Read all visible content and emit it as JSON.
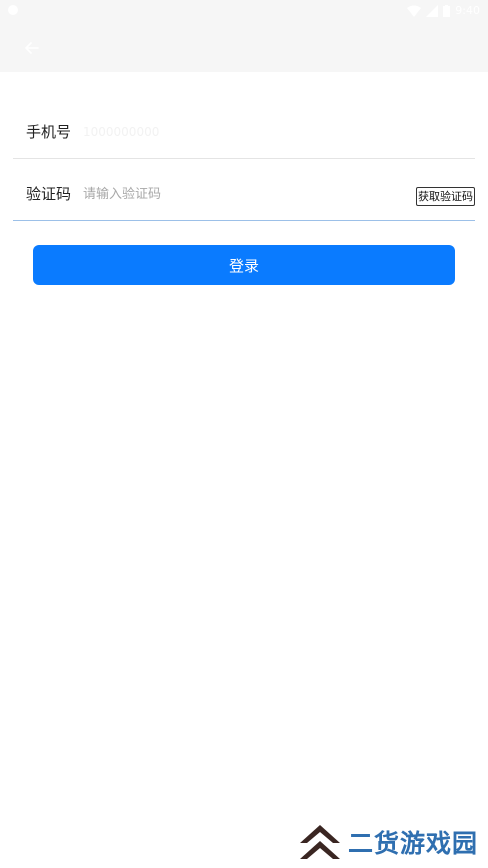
{
  "status_bar": {
    "time": "9:40",
    "icons": [
      "notification-icon",
      "wifi-icon",
      "signal-icon",
      "battery-icon"
    ]
  },
  "app_bar": {
    "back_icon": "arrow-left-icon"
  },
  "form": {
    "phone": {
      "label": "手机号",
      "value": "1000000000"
    },
    "code": {
      "label": "验证码",
      "placeholder": "请输入验证码",
      "get_code_label": "获取验证码"
    },
    "login_label": "登录"
  },
  "watermark": {
    "text": "二货游戏园"
  },
  "colors": {
    "accent": "#0a7bff",
    "app_bar_bg": "#f6f6f6",
    "divider": "#e4e4e4",
    "active_divider": "#9cc0e8",
    "watermark_blue": "#2f6fb0",
    "watermark_logo": "#3a2622"
  }
}
